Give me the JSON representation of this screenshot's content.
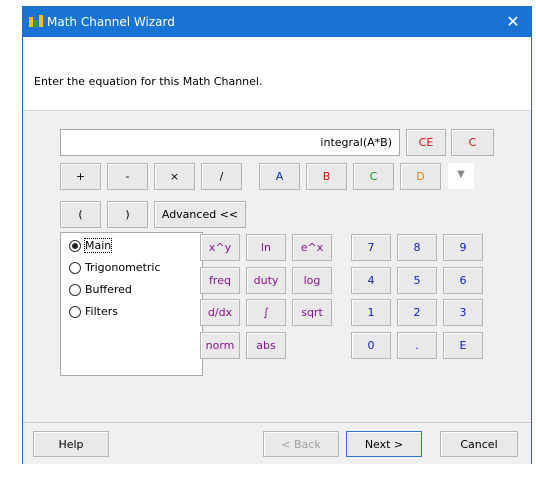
{
  "window": {
    "title": "Math Channel Wizard",
    "close_glyph": "✕",
    "accent_color": "#1873d3"
  },
  "header": {
    "instruction": "Enter the equation for this Math Channel."
  },
  "equation": {
    "value": "integral(A*B)"
  },
  "clear_buttons": {
    "ce": "CE",
    "c": "C"
  },
  "operators": [
    "+",
    "-",
    "×",
    "/"
  ],
  "channels": [
    "A",
    "B",
    "C",
    "D"
  ],
  "parens": [
    "(",
    ")"
  ],
  "advanced_label": "Advanced <<",
  "function_categories": [
    {
      "label": "Main",
      "selected": true
    },
    {
      "label": "Trigonometric",
      "selected": false
    },
    {
      "label": "Buffered",
      "selected": false
    },
    {
      "label": "Filters",
      "selected": false
    }
  ],
  "functions": [
    "x^y",
    "ln",
    "e^x",
    "freq",
    "duty",
    "log",
    "d/dx",
    "∫",
    "sqrt",
    "norm",
    "abs"
  ],
  "keypad": [
    "7",
    "8",
    "9",
    "4",
    "5",
    "6",
    "1",
    "2",
    "3",
    "0",
    ".",
    "E"
  ],
  "footer": {
    "help": "Help",
    "back": "< Back",
    "next": "Next >",
    "cancel": "Cancel"
  },
  "icons": {
    "app": "math-channel-app-icon",
    "dropdown": "chevron-down-icon"
  }
}
